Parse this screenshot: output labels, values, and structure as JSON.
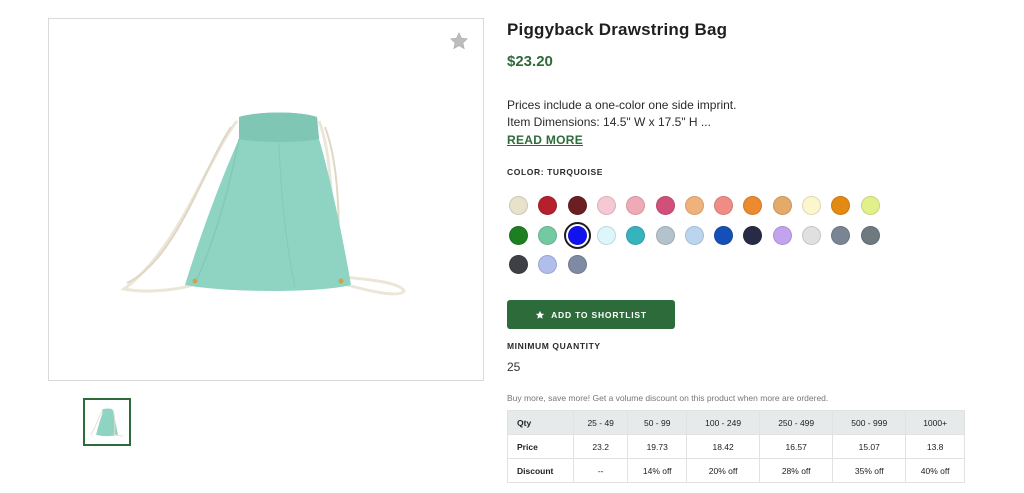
{
  "product": {
    "title": "Piggyback Drawstring Bag",
    "price": "$23.20",
    "description_line1": "Prices include a one-color one side imprint.",
    "description_line2": "Item Dimensions: 14.5\" W x 17.5\" H ...",
    "read_more": "READ MORE",
    "image_color": "#8fd4c3"
  },
  "color": {
    "label": "COLOR: TURQUOISE",
    "selected_index": 15,
    "swatches": [
      "#e8e2cc",
      "#b51f2e",
      "#6b1f24",
      "#f6c8d4",
      "#efaab7",
      "#d1507a",
      "#efb27a",
      "#ef8c84",
      "#eb8a2e",
      "#e3aa6a",
      "#fbf6cc",
      "#e38a12",
      "#e2f08a",
      "#1d7f22",
      "#73c9a1",
      "#1212f0",
      "#dcf6fb",
      "#36b3bd",
      "#b4c3cb",
      "#bcd5ef",
      "#1550b8",
      "#282b45",
      "#c2a4ee",
      "#e0e0e0",
      "#7a8593",
      "#6e7a80",
      "#3e4045",
      "#b1bdeb",
      "#7f8aa3"
    ]
  },
  "actions": {
    "shortlist_label": "ADD TO SHORTLIST"
  },
  "minimum": {
    "label": "MINIMUM QUANTITY",
    "value": "25"
  },
  "volume_note": "Buy more, save more! Get a volume discount on this product when more are ordered.",
  "pricing": {
    "header": [
      "Qty",
      "25 - 49",
      "50 - 99",
      "100 - 249",
      "250 - 499",
      "500 - 999",
      "1000+"
    ],
    "rows": [
      [
        "Price",
        "23.2",
        "19.73",
        "18.42",
        "16.57",
        "15.07",
        "13.8"
      ],
      [
        "Discount",
        "--",
        "14% off",
        "20% off",
        "28% off",
        "35% off",
        "40% off"
      ]
    ]
  },
  "theme": {
    "accent": "#2e6b3a"
  }
}
